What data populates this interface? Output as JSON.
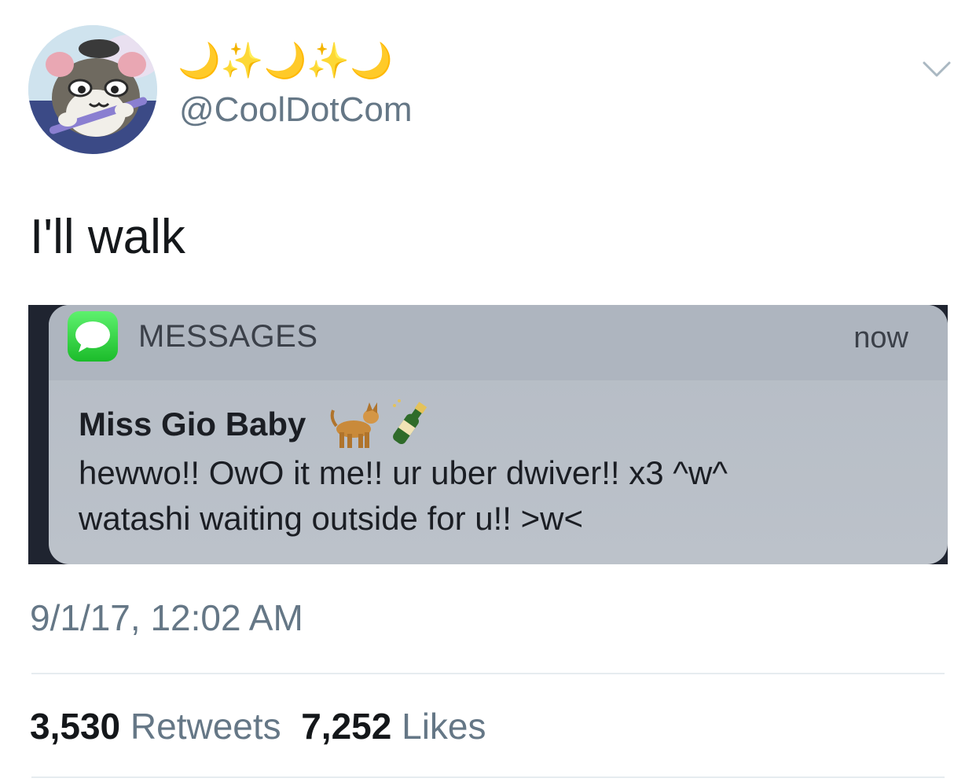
{
  "tweet": {
    "display_name": "🌙✨🌙✨🌙",
    "handle": "@CoolDotCom",
    "text": "I'll walk",
    "timestamp": "9/1/17, 12:02 AM",
    "retweets_count": "3,530",
    "retweets_label": "Retweets",
    "likes_count": "7,252",
    "likes_label": "Likes",
    "icons": {
      "avatar": "avatar-cartoon-hamster",
      "menu": "chevron-down-icon"
    }
  },
  "notification": {
    "app_name": "MESSAGES",
    "time": "now",
    "sender": "Miss Gio Baby",
    "sender_emoji": [
      "dog-emoji",
      "champagne-emoji"
    ],
    "lines": [
      "hewwo!! OwO it me!! ur uber dwiver!! x3 ^w^",
      "watashi waiting outside for u!! >w<"
    ],
    "icon": "messages-app-icon"
  },
  "colors": {
    "text_primary": "#14171a",
    "text_secondary": "#657786",
    "divider": "#e6ecf0",
    "messages_green": "#2fd43e"
  }
}
